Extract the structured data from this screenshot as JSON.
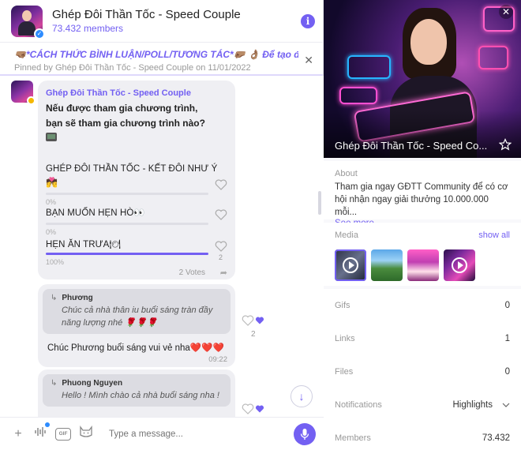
{
  "header": {
    "title": "Ghép Đôi Thần Tốc - Speed Couple",
    "subtitle": "73.432 members",
    "info_glyph": "i"
  },
  "pinned": {
    "text": "🤜🏽*CÁCH THỨC BÌNH LUẬN/POLL/TƯƠNG TÁC*🤛🏽 👌🏽 Để tạo điề...",
    "meta": "Pinned by Ghép Đôi Thần Tốc - Speed Couple on 11/01/2022"
  },
  "poll": {
    "author": "Ghép Đôi Thần Tốc - Speed Couple",
    "question_line1": "Nếu được tham gia chương trình,",
    "question_line2": "bạn sẽ tham gia chương trình nào?",
    "options": [
      {
        "label": "GHÉP ĐÔI THẦN TỐC - KẾT ĐÔI NHƯ Ý",
        "emoji": "💏",
        "percent": "0%",
        "fraction": 0.0,
        "votes": ""
      },
      {
        "label": "BẠN MUỐN HẸN HÒ👀",
        "emoji": "",
        "percent": "0%",
        "fraction": 0.0,
        "votes": ""
      },
      {
        "label": "HẸN ĂN TRƯA🍽",
        "emoji": "",
        "percent": "100%",
        "fraction": 1.0,
        "votes": "2"
      }
    ],
    "total_votes": "2 Votes"
  },
  "messages": [
    {
      "quote_author": "Phương",
      "quote_text": "Chúc cả nhà thân iu buổi sáng tràn đầy năng lượng nhé 🌹🌹🌹",
      "text": "Chúc Phương buổi sáng vui vẻ nha❤️❤️❤️",
      "time": "09:22",
      "reaction_count": "2"
    },
    {
      "quote_author": "Phuong Nguyen",
      "quote_text": "Hello ! Mình chào cả nhà buổi sáng nha !",
      "text": "",
      "time": "",
      "reaction_count": ""
    }
  ],
  "composer": {
    "placeholder": "Type a message...",
    "gif_label": "GIF"
  },
  "info_panel": {
    "hero_title": "Ghép Đôi Thần Tốc - Speed Co...",
    "about_label": "About",
    "about_text": "Tham gia ngay GĐTT Community để có cơ hội nhận ngay giải thưởng 10.000.000 mỗi...",
    "see_more": "See more",
    "media_label": "Media",
    "show_all": "show all",
    "rows": [
      {
        "label": "Gifs",
        "value": "0"
      },
      {
        "label": "Links",
        "value": "1"
      },
      {
        "label": "Files",
        "value": "0"
      },
      {
        "label": "Notifications",
        "value": "Highlights"
      },
      {
        "label": "Members",
        "value": "73.432"
      }
    ]
  },
  "colors": {
    "accent": "#7360f2",
    "bubble": "#efeff3",
    "verified": "#2d8cff"
  },
  "icons": [
    "info-icon",
    "close-icon",
    "heart-outline-icon",
    "heart-filled-icon",
    "share-icon",
    "arrow-down-icon",
    "plus-icon",
    "audio-wave-icon",
    "gif-icon",
    "sticker-cat-icon",
    "microphone-icon",
    "star-icon",
    "play-icon",
    "chevron-down-icon"
  ]
}
